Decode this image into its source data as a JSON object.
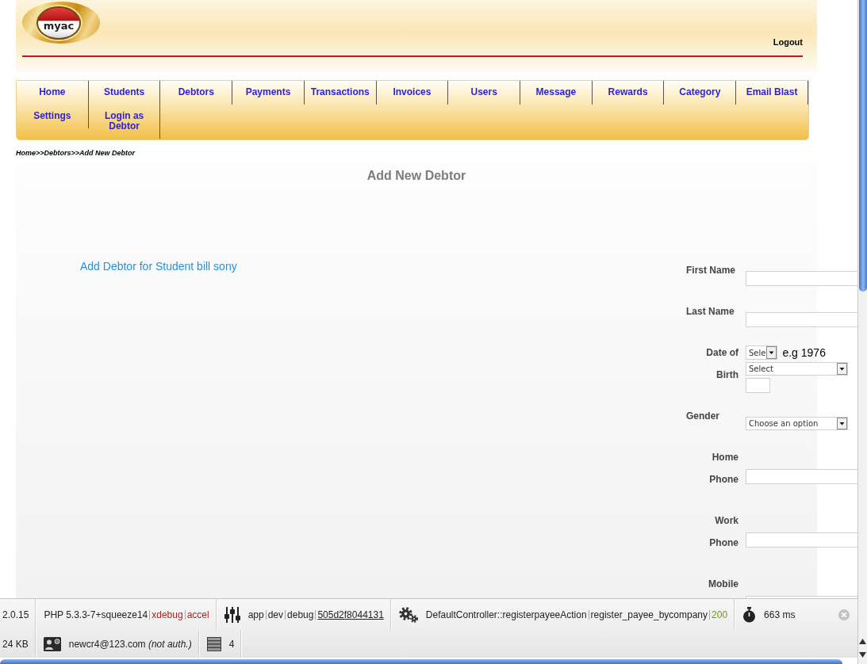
{
  "header": {
    "logo": "myac",
    "logout": "Logout"
  },
  "nav": {
    "items": [
      "Home",
      "Students",
      "Debtors",
      "Payments",
      "Transactions",
      "Invoices",
      "Users",
      "Message",
      "Rewards",
      "Category",
      "Email Blast",
      "Settings",
      "Login as Debtor"
    ]
  },
  "breadcrumb": "Home>>Debtors>>Add New Debtor",
  "page": {
    "title": "Add New Debtor",
    "subtitle": "Add Debtor for Student bill sony"
  },
  "form": {
    "fields": [
      {
        "kind": "text",
        "label": "First Name"
      },
      {
        "kind": "text",
        "label": "Last Name"
      },
      {
        "kind": "date",
        "label": "Date of Birth",
        "dropdowns": [
          "Sele",
          "Select"
        ],
        "hint": "e.g 1976"
      },
      {
        "kind": "select",
        "label": "Gender",
        "value": "Choose an option"
      },
      {
        "kind": "phone",
        "label": "Home Phone"
      },
      {
        "kind": "phone",
        "label": "Work Phone"
      },
      {
        "kind": "phone",
        "label": "Mobile"
      }
    ]
  },
  "debug_bar": {
    "version": "2.0.15",
    "php": {
      "version": "PHP 5.3.3-7+squeeze14",
      "extensions": [
        {
          "name": "xdebug",
          "enabled": false
        },
        {
          "name": "accel",
          "enabled": false
        }
      ]
    },
    "config": {
      "parts": [
        "app",
        "dev",
        "debug"
      ],
      "token": "505d2f8044131"
    },
    "request": {
      "parts": [
        "DefaultController::registerpayeeAction",
        "register_payee_bycompany"
      ],
      "status": "200",
      "status_ok": true
    },
    "time": "663 ms",
    "memory": "24 KB",
    "user": {
      "email": "newcr4@123.com",
      "note": "(not auth.)"
    },
    "queries": "4"
  }
}
